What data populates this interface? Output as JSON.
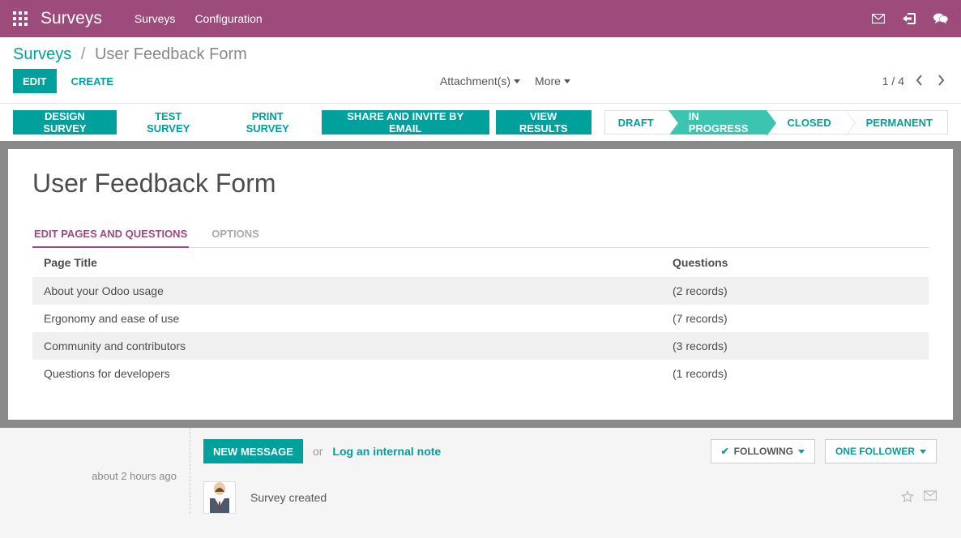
{
  "topbar": {
    "brand": "Surveys",
    "nav": [
      "Surveys",
      "Configuration"
    ]
  },
  "breadcrumb": {
    "root": "Surveys",
    "current": "User Feedback Form"
  },
  "controls": {
    "edit": "EDIT",
    "create": "CREATE",
    "attachments": "Attachment(s)",
    "more": "More",
    "pager": "1 / 4"
  },
  "actions": {
    "design": "DESIGN SURVEY",
    "test": "TEST SURVEY",
    "print": "PRINT SURVEY",
    "share": "SHARE AND INVITE BY EMAIL",
    "view": "VIEW RESULTS"
  },
  "status": {
    "items": [
      "DRAFT",
      "IN PROGRESS",
      "CLOSED",
      "PERMANENT"
    ],
    "active_index": 1
  },
  "form": {
    "title": "User Feedback Form",
    "tabs": [
      "EDIT PAGES AND QUESTIONS",
      "OPTIONS"
    ],
    "table": {
      "headers": {
        "title": "Page Title",
        "questions": "Questions"
      },
      "rows": [
        {
          "title": "About your Odoo usage",
          "questions": "(2 records)"
        },
        {
          "title": "Ergonomy and ease of use",
          "questions": "(7 records)"
        },
        {
          "title": "Community and contributors",
          "questions": "(3 records)"
        },
        {
          "title": "Questions for developers",
          "questions": "(1 records)"
        }
      ]
    }
  },
  "chatter": {
    "new_message": "NEW MESSAGE",
    "or": "or",
    "log_note": "Log an internal note",
    "following": "FOLLOWING",
    "follower": "ONE FOLLOWER",
    "timestamp": "about 2 hours ago",
    "message": "Survey created"
  },
  "colors": {
    "brand_purple": "#9c4b7a",
    "teal": "#00a09d",
    "teal_light": "#3bc4b0"
  }
}
